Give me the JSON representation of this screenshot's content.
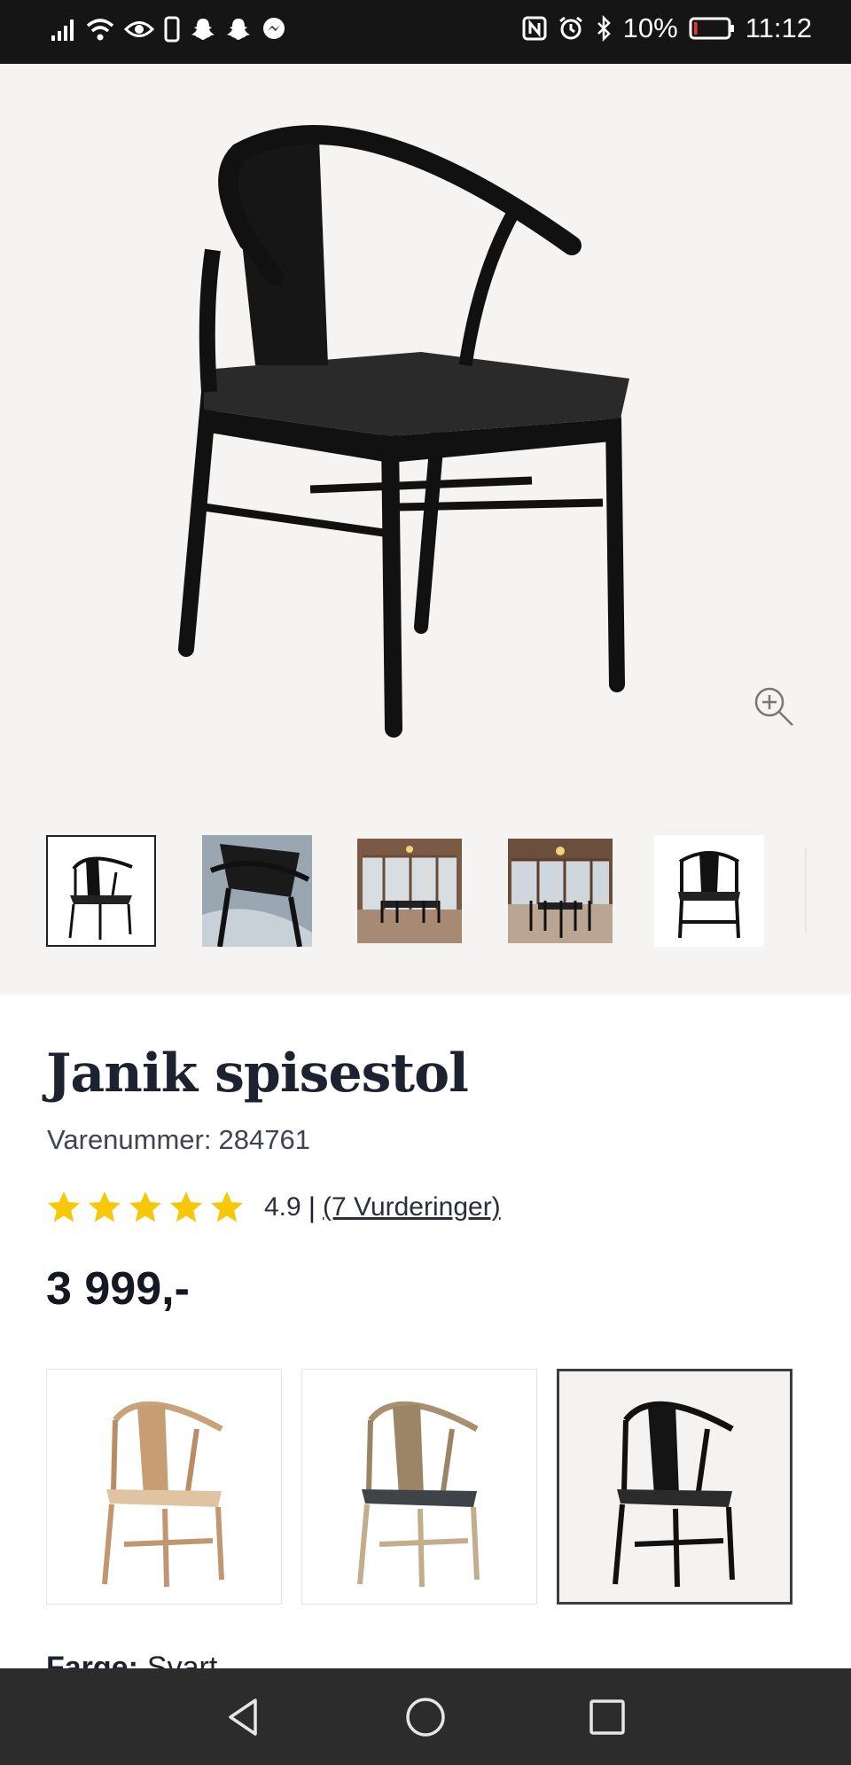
{
  "status_bar": {
    "battery_percent": "10%",
    "time": "11:12",
    "battery_level": 0.1,
    "left_icons": [
      "signal-icon",
      "wifi-icon",
      "eye-icon",
      "phone-icon",
      "snapchat-icon",
      "snapchat-icon",
      "messenger-icon"
    ],
    "right_icons": [
      "nfc-icon",
      "alarm-icon",
      "bluetooth-icon",
      "battery-icon"
    ]
  },
  "gallery": {
    "thumbnails": [
      {
        "name": "chair-front",
        "active": true
      },
      {
        "name": "chair-detail",
        "active": false
      },
      {
        "name": "dining-room",
        "active": false
      },
      {
        "name": "dining-room-sea-view",
        "active": false
      },
      {
        "name": "chair-front-white",
        "active": false
      }
    ],
    "zoom_icon": "zoom-in-icon"
  },
  "product": {
    "title": "Janik spisestol",
    "sku_label": "Varenummer:",
    "sku": "284761",
    "rating_value": "4.9",
    "rating_separator": "|",
    "reviews_link": "(7 Vurderinger)",
    "stars": 5,
    "price": "3 999,-"
  },
  "variants": [
    {
      "name": "natural-oak",
      "selected": false
    },
    {
      "name": "oak-grey-seat",
      "selected": false
    },
    {
      "name": "black",
      "selected": true
    }
  ],
  "color": {
    "label": "Farge:",
    "value": "Svart"
  },
  "colors": {
    "star": "#f7c80a",
    "text_dark": "#1c2230",
    "hero_bg": "#f5f4f2",
    "status_bg": "#151515",
    "nav_bg": "#2c2c2c"
  },
  "nav_bar": {
    "icons": [
      "back-icon",
      "home-icon",
      "recents-icon"
    ]
  }
}
